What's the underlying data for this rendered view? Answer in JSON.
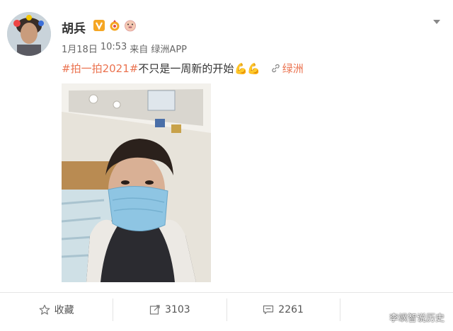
{
  "post": {
    "username": "胡兵",
    "badges": [
      "verified-v-icon",
      "ring-badge-icon",
      "pig-emoji-icon"
    ],
    "meta": {
      "date": "1月18日",
      "time": "10:53",
      "source": "来自 绿洲APP"
    },
    "content": {
      "hashtag": "#拍一拍2021#",
      "text": "不只是一周新的开始",
      "emoji": "💪💪",
      "location": "绿洲"
    },
    "image": {
      "icon": "selfie-photo"
    }
  },
  "actions": {
    "favorite_label": "收藏",
    "repost_count": "3103",
    "comment_count": "2261"
  },
  "watermark": "李飒智说历史",
  "colors": {
    "accent": "#eb7350",
    "verified": "#f5a623",
    "text": "#333333",
    "muted": "#666666"
  }
}
